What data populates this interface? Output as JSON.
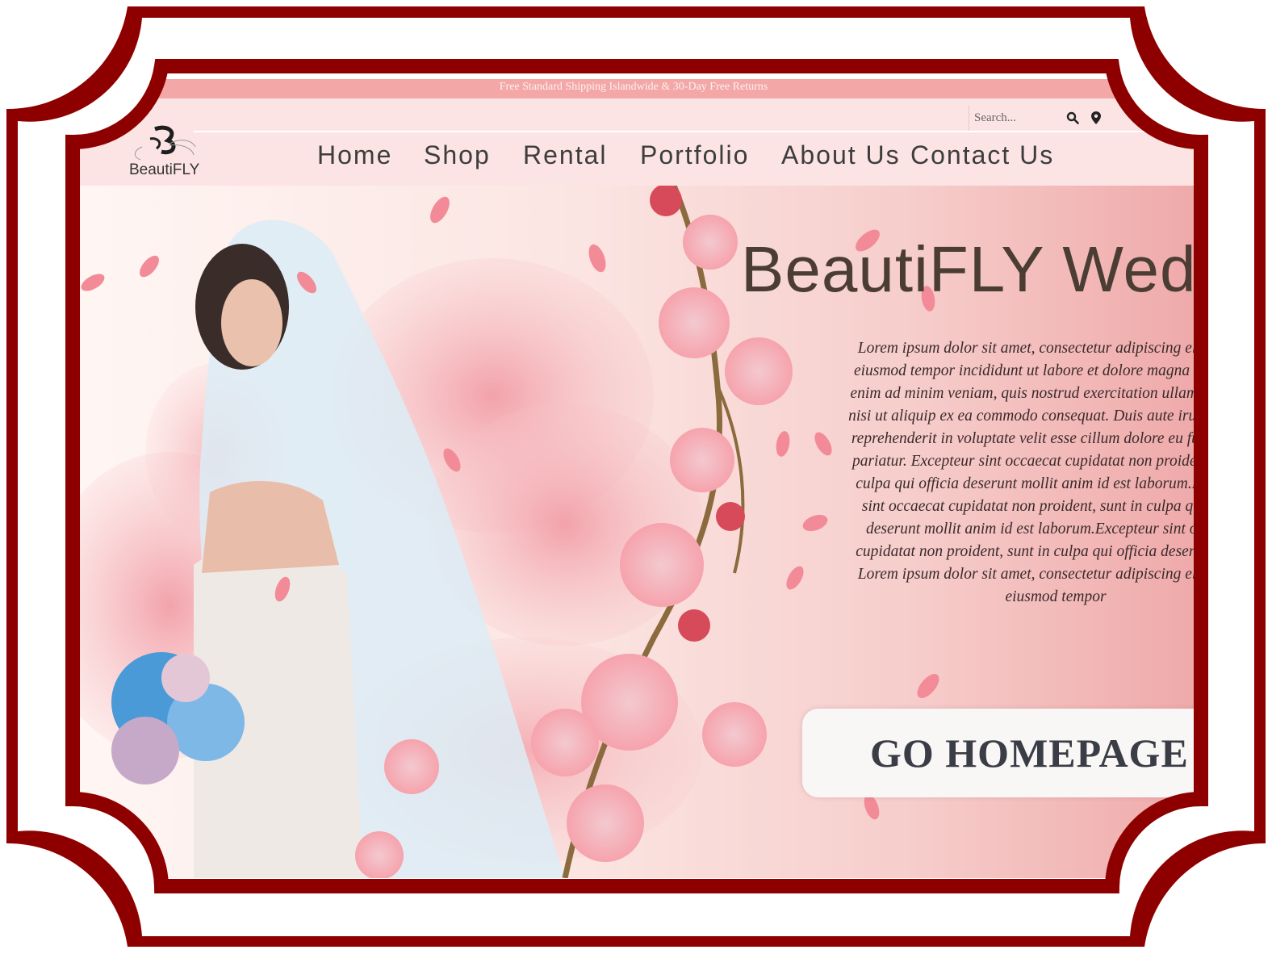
{
  "topbar": {
    "announcement": "Free Standard Shipping Islandwide & 30-Day Free Returns"
  },
  "header": {
    "logo_text": "BeautiFLY",
    "search_placeholder": "Search..."
  },
  "nav": {
    "items": [
      {
        "label": "Home"
      },
      {
        "label": "Shop"
      },
      {
        "label": "Rental"
      },
      {
        "label": "Portfolio"
      },
      {
        "label": "About Us"
      },
      {
        "label": "Contact Us"
      }
    ]
  },
  "hero": {
    "title": "BeautiFLY Wedding",
    "body": "Lorem ipsum dolor sit amet, consectetur adipiscing elit, sed do eiusmod tempor incididunt ut labore et dolore magna aliqua. Ut enim ad minim veniam, quis nostrud exercitation ullamco laboris nisi ut aliquip ex ea commodo consequat. Duis aute irure dolor in reprehenderit in voluptate velit esse cillum dolore eu fugiat nulla pariatur. Excepteur sint occaecat cupidatat non proident, sunt in culpa qui officia deserunt mollit anim id est laborum.Excepteur sint occaecat cupidatat non proident, sunt in culpa qui officia deserunt mollit anim id est laborum.Excepteur sint occaecat cupidatat non proident, sunt in culpa qui officia deserunt mollit Lorem ipsum dolor sit amet, consectetur adipiscing elit, sed do eiusmod tempor",
    "cta_label": "GO HOMEPAGE"
  },
  "colors": {
    "frame": "#8e0000",
    "topbar": "#f3a7a7",
    "header": "#fde4e4",
    "title": "#4b3d33"
  },
  "icons": [
    "logo-butterfly-icon",
    "search-icon",
    "location-pin-icon"
  ]
}
